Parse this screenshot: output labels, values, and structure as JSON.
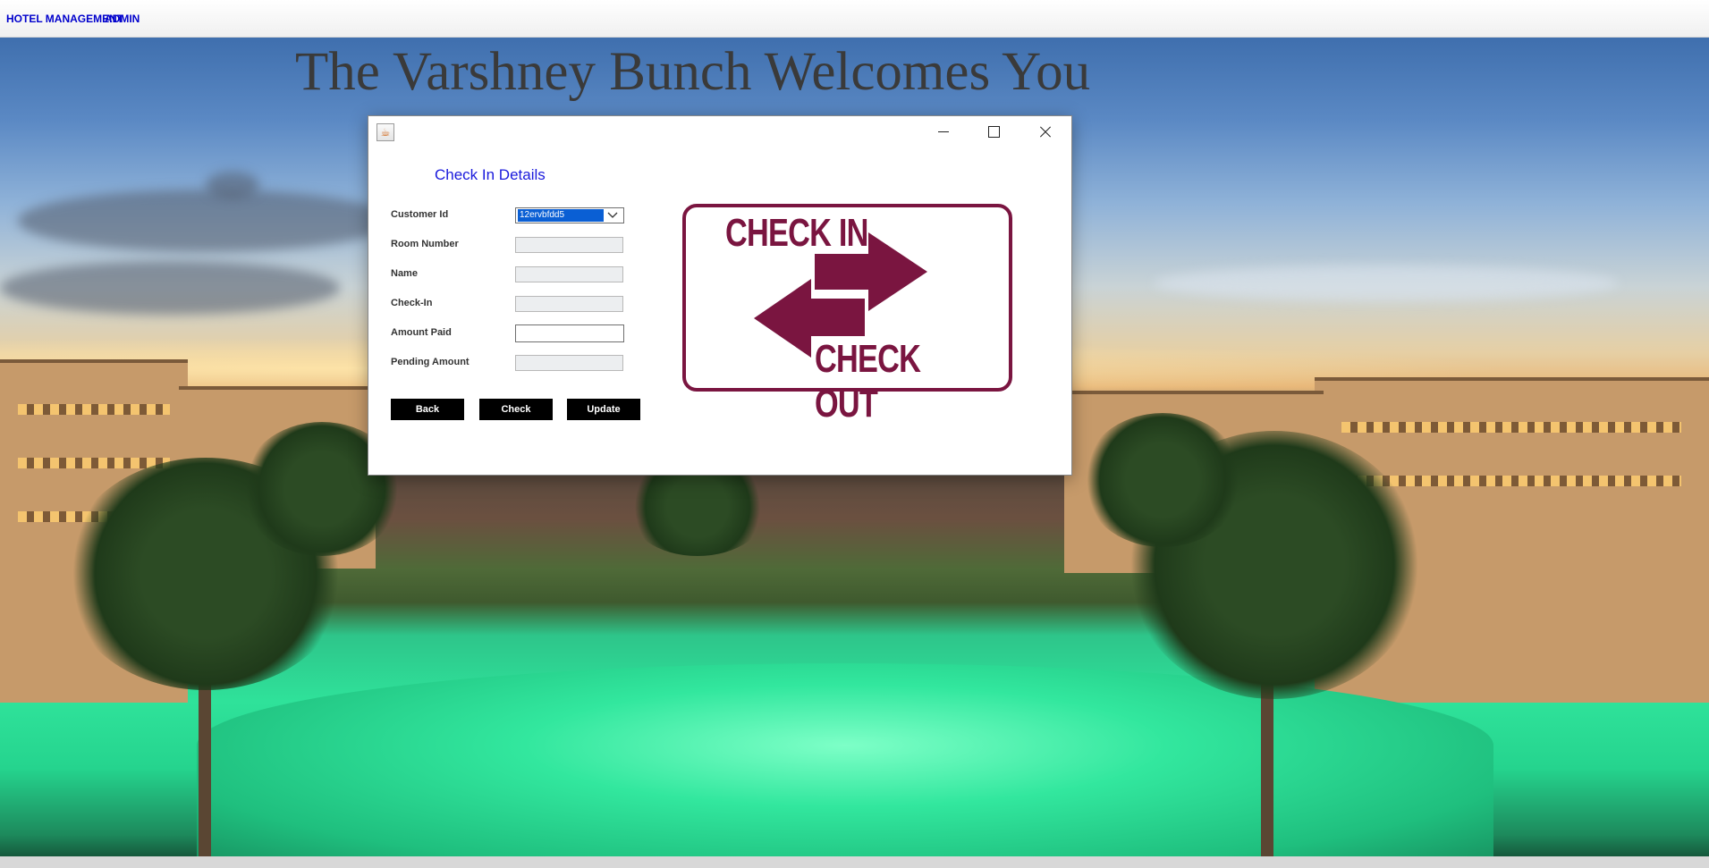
{
  "menubar": {
    "items": [
      {
        "label": "HOTEL MANAGEMENT"
      },
      {
        "label": "ADMIN"
      }
    ]
  },
  "main": {
    "heading": "The Varshney Bunch Welcomes You"
  },
  "dialog": {
    "title": "Check In Details",
    "fields": {
      "customer_id": {
        "label": "Customer Id",
        "value": "12ervbfdd5"
      },
      "room_number": {
        "label": "Room Number",
        "value": ""
      },
      "name": {
        "label": "Name",
        "value": ""
      },
      "check_in": {
        "label": "Check-In",
        "value": ""
      },
      "amount_paid": {
        "label": "Amount Paid",
        "value": ""
      },
      "pending_amount": {
        "label": "Pending Amount",
        "value": ""
      }
    },
    "buttons": {
      "back": "Back",
      "check": "Check",
      "update": "Update"
    },
    "sign": {
      "top_text": "CHECK IN",
      "bottom_text": "CHECK OUT",
      "color": "#7a1540"
    }
  },
  "colors": {
    "menu_text": "#0000cc",
    "dialog_title": "#1a1adc",
    "button_bg": "#000000",
    "selection": "#0a5fd4"
  },
  "icons": {
    "window_icon": "java-cup-icon",
    "minimize": "minimize-icon",
    "maximize": "maximize-icon",
    "close": "close-icon",
    "dropdown": "chevron-down-icon"
  }
}
